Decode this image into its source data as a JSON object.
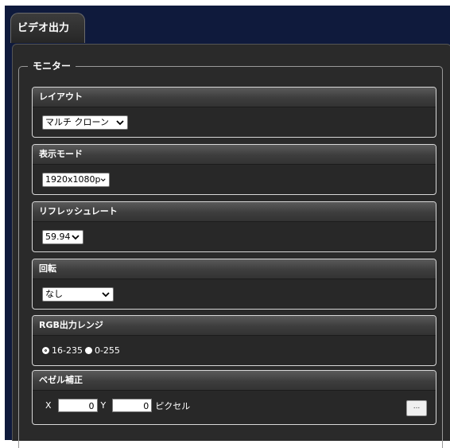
{
  "tab": {
    "label": "ビデオ出力"
  },
  "monitor": {
    "legend": "モニター"
  },
  "layout": {
    "title": "レイアウト",
    "selected": "マルチ クローン"
  },
  "display_mode": {
    "title": "表示モード",
    "selected": "1920x1080p"
  },
  "refresh_rate": {
    "title": "リフレッシュレート",
    "selected": "59.94"
  },
  "rotation": {
    "title": "回転",
    "selected": "なし"
  },
  "rgb_range": {
    "title": "RGB出力レンジ",
    "options": [
      {
        "label": "16-235",
        "checked": true
      },
      {
        "label": "0-255",
        "checked": false
      }
    ]
  },
  "bezel": {
    "title": "ベゼル補正",
    "x_label": "X",
    "x_value": "0",
    "y_label": "Y",
    "y_value": "0",
    "unit": "ピクセル",
    "button_label": "..."
  },
  "colors": {
    "footnote": "#d21c1c",
    "background": "#0f1a3c",
    "panel": "#2a2a2a"
  }
}
